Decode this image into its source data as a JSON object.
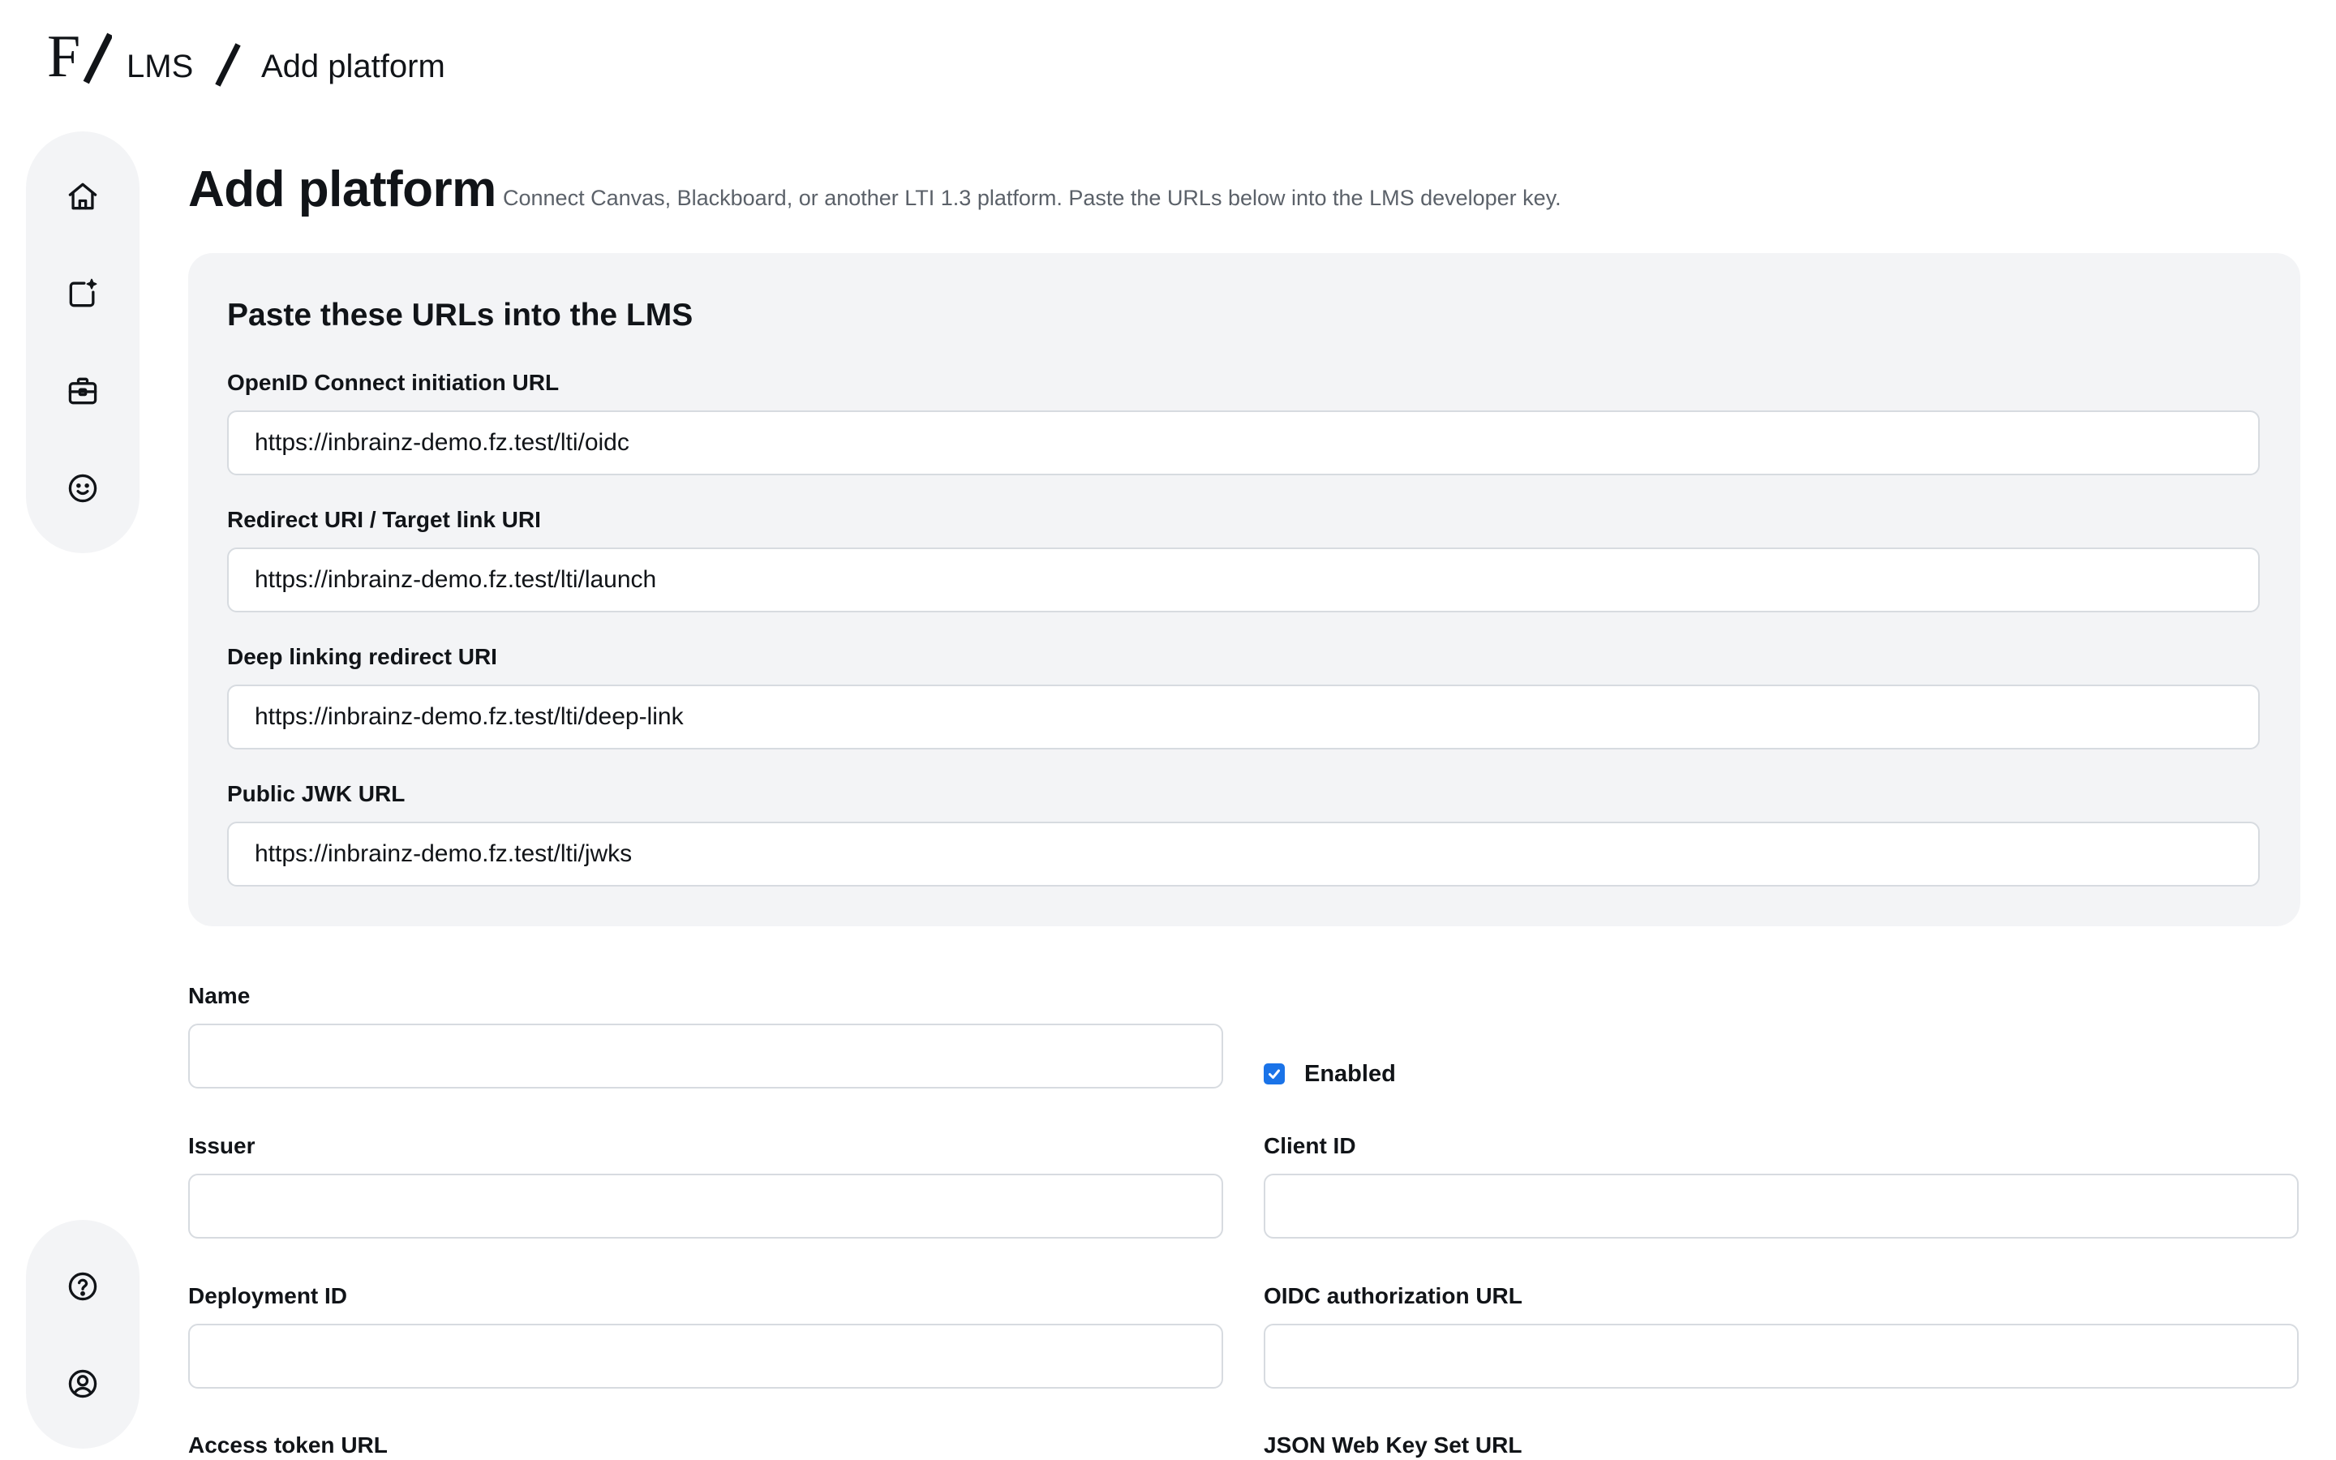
{
  "app": {
    "logo_icon": "fz-logo-icon",
    "breadcrumb": {
      "root": "LMS",
      "separator_icon": "slash-icon",
      "current": "Add platform"
    }
  },
  "sidebar": {
    "top_items": [
      {
        "icon": "home-icon",
        "label": "Home"
      },
      {
        "icon": "new-content-icon",
        "label": "Create"
      },
      {
        "icon": "briefcase-icon",
        "label": "Tools"
      },
      {
        "icon": "smiley-icon",
        "label": "Feedback"
      }
    ],
    "bottom_items": [
      {
        "icon": "help-icon",
        "label": "Help"
      },
      {
        "icon": "account-icon",
        "label": "Account"
      }
    ]
  },
  "header": {
    "title": "Add platform",
    "subtitle": "Connect Canvas, Blackboard, or another LTI 1.3 platform. Paste the URLs below into the LMS developer key."
  },
  "urls_panel": {
    "heading": "Paste these URLs into the LMS",
    "fields": [
      {
        "label": "OpenID Connect initiation URL",
        "value": "https://inbrainz-demo.fz.test/lti/oidc"
      },
      {
        "label": "Redirect URI / Target link URI",
        "value": "https://inbrainz-demo.fz.test/lti/launch"
      },
      {
        "label": "Deep linking redirect URI",
        "value": "https://inbrainz-demo.fz.test/lti/deep-link"
      },
      {
        "label": "Public JWK URL",
        "value": "https://inbrainz-demo.fz.test/lti/jwks"
      }
    ]
  },
  "form": {
    "name": {
      "label": "Name",
      "value": ""
    },
    "enabled": {
      "label": "Enabled",
      "checked": true
    },
    "issuer": {
      "label": "Issuer",
      "value": ""
    },
    "client_id": {
      "label": "Client ID",
      "value": ""
    },
    "deployment_id": {
      "label": "Deployment ID",
      "value": ""
    },
    "oidc_authorization_url": {
      "label": "OIDC authorization URL",
      "value": ""
    },
    "access_token_url": {
      "label": "Access token URL",
      "value": ""
    },
    "jwks_url": {
      "label": "JSON Web Key Set URL",
      "value": ""
    }
  },
  "colors": {
    "accent": "#1a73e8",
    "panel_bg": "#f3f4f6",
    "border": "#d7dbe0",
    "text": "#111418",
    "muted_text": "#5b6169"
  }
}
